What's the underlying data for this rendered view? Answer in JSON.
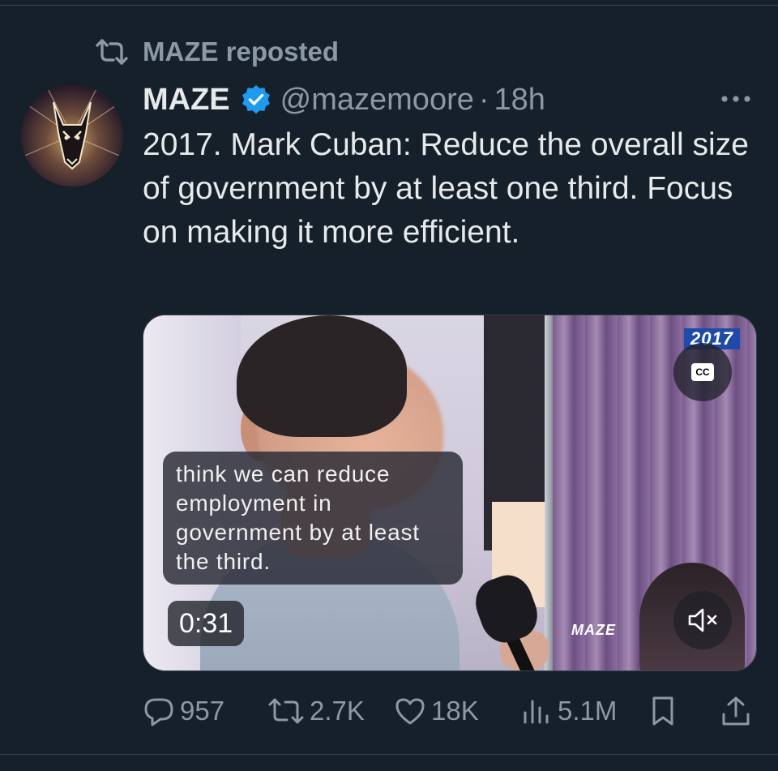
{
  "repost": {
    "label": "MAZE reposted",
    "icon": "repost-icon"
  },
  "author": {
    "display_name": "MAZE",
    "handle": "@mazemoore",
    "separator": "·",
    "time": "18h",
    "verified": true,
    "avatar_icon": "doberman-avatar"
  },
  "tweet": {
    "text": "2017. Mark Cuban: Reduce the overall size of government by at least one third. Focus on making it more efficient."
  },
  "media": {
    "year_badge": "2017",
    "cc_label": "CC",
    "caption": "think we can reduce employment in government by at least the third.",
    "duration": "0:31",
    "watermark": "MAZE",
    "muted": true
  },
  "actions": {
    "replies": "957",
    "reposts": "2.7K",
    "likes": "18K",
    "views": "5.1M"
  },
  "colors": {
    "background": "#15202b",
    "secondary_text": "#8b98a5",
    "primary_text": "#e7e9ea",
    "verified_blue": "#1d9bf0"
  }
}
